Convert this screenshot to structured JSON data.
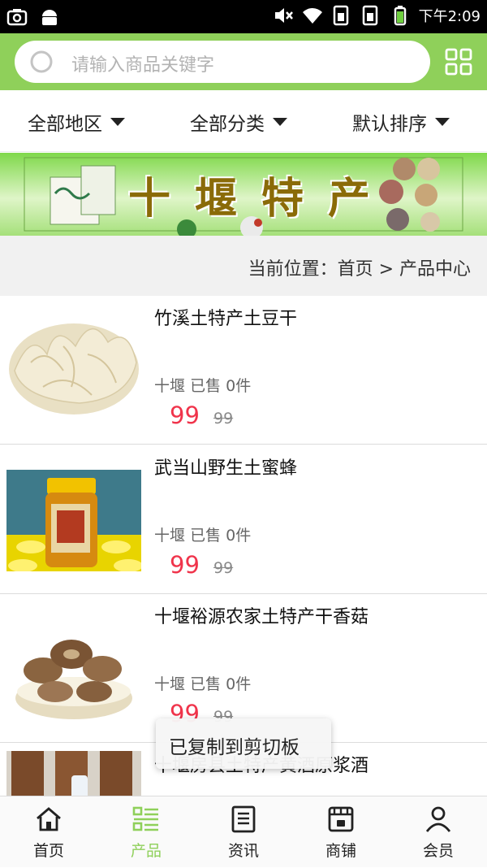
{
  "status_bar": {
    "time": "下午2:09"
  },
  "search": {
    "placeholder": "请输入商品关键字",
    "search_icon": "search-icon",
    "grid_icon": "grid-menu-icon"
  },
  "filters": [
    {
      "label": "全部地区"
    },
    {
      "label": "全部分类"
    },
    {
      "label": "默认排序"
    }
  ],
  "banner": {
    "title": "十堰特产"
  },
  "breadcrumb": {
    "text": "当前位置：首页 > 产品中心"
  },
  "products": [
    {
      "title": "竹溪土特产土豆干",
      "location": "十堰",
      "sold": "已售 0件",
      "price": "99",
      "original_price": "99",
      "image": "dried-potato-slices"
    },
    {
      "title": "武当山野生土蜜蜂",
      "location": "十堰",
      "sold": "已售 0件",
      "price": "99",
      "original_price": "99",
      "image": "honey-jar"
    },
    {
      "title": "十堰裕源农家土特产干香菇",
      "location": "十堰",
      "sold": "已售 0件",
      "price": "99",
      "original_price": "99",
      "image": "dried-shiitake-bowl"
    },
    {
      "title": "十堰房县土特产黄酒原浆酒",
      "image": "rice-wine-barrel"
    }
  ],
  "toast": {
    "text": "已复制到剪切板"
  },
  "bottom_nav": [
    {
      "label": "首页",
      "icon": "home-icon"
    },
    {
      "label": "产品",
      "icon": "product-list-icon",
      "active": true
    },
    {
      "label": "资讯",
      "icon": "news-icon"
    },
    {
      "label": "商铺",
      "icon": "shop-icon"
    },
    {
      "label": "会员",
      "icon": "member-icon"
    }
  ],
  "colors": {
    "accent": "#8fd05a",
    "price": "#f0344b"
  }
}
